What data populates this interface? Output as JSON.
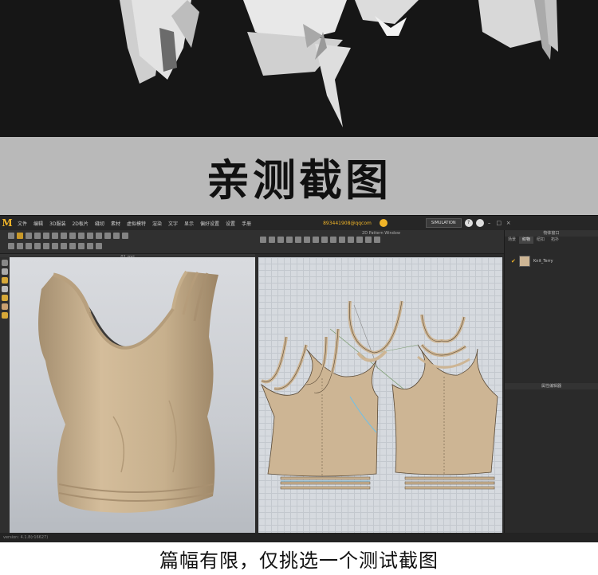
{
  "page": {
    "heading": "亲测截图",
    "caption": "篇幅有限，仅挑选一个测试截图"
  },
  "app": {
    "logo": "M",
    "menu": [
      "文件",
      "编辑",
      "3D服装",
      "2D板片",
      "缝纫",
      "素材",
      "虚拟模特",
      "渲染",
      "文字",
      "显示",
      "偏好设置",
      "设置",
      "手册"
    ],
    "account": "893441908@qqcom",
    "simulation_label": "SIMULATION",
    "help_icon": "?",
    "viewport_label": "01.zprj",
    "pattern_window_label": "2D Pattern Window",
    "window_controls": [
      "–",
      "□",
      "×"
    ]
  },
  "right_panel": {
    "header": "物体窗口",
    "tabs": [
      "场景",
      "织物",
      "纽扣",
      "拓扑"
    ],
    "active_tab": 1,
    "fabric_name": "Knit_Terry",
    "fabric_color": "#cdb594",
    "properties_header": "属性编辑器"
  },
  "status": {
    "text": "version: 4.1.8(r16627)"
  },
  "colors": {
    "accent": "#f0b428",
    "garment": "#cdb594",
    "app_bg": "#2b2b2b"
  }
}
